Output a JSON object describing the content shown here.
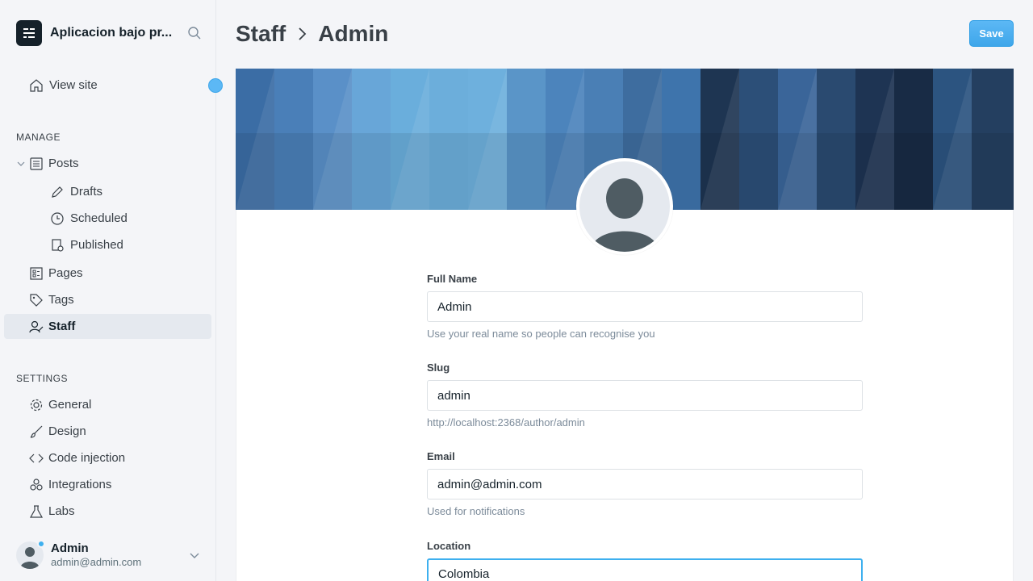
{
  "brand": {
    "title": "Aplicacion bajo pr...",
    "logo_icon": "ghost-logo-icon",
    "search_icon": "search-icon"
  },
  "nav": {
    "view_site": "View site",
    "manage_title": "MANAGE",
    "posts": "Posts",
    "drafts": "Drafts",
    "scheduled": "Scheduled",
    "published": "Published",
    "pages": "Pages",
    "tags": "Tags",
    "staff": "Staff",
    "settings_title": "SETTINGS",
    "general": "General",
    "design": "Design",
    "code_injection": "Code injection",
    "integrations": "Integrations",
    "labs": "Labs"
  },
  "user": {
    "name": "Admin",
    "email": "admin@admin.com"
  },
  "header": {
    "crumb_parent": "Staff",
    "crumb_current": "Admin",
    "save_label": "Save"
  },
  "form": {
    "full_name": {
      "label": "Full Name",
      "value": "Admin",
      "hint": "Use your real name so people can recognise you"
    },
    "slug": {
      "label": "Slug",
      "value": "admin",
      "hint": "http://localhost:2368/author/admin"
    },
    "email": {
      "label": "Email",
      "value": "admin@admin.com",
      "hint": "Used for notifications"
    },
    "location": {
      "label": "Location",
      "value": "Colombia"
    }
  },
  "colors": {
    "accent": "#3eb0ef",
    "sidebar_bg": "#f4f5f8",
    "active_bg": "#e5e9ef",
    "text": "#15212a"
  }
}
